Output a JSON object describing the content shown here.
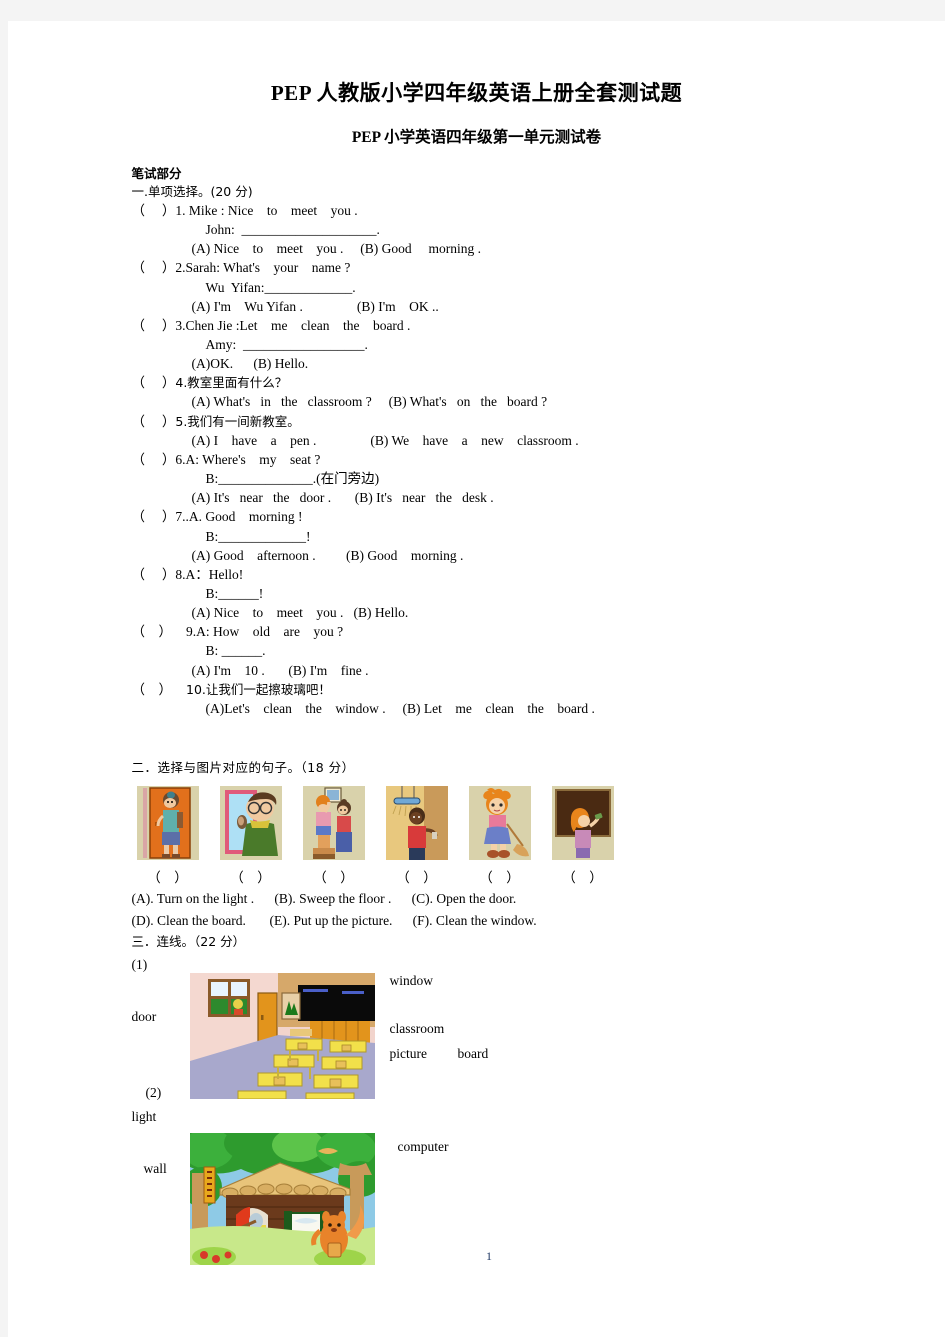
{
  "document": {
    "title": "PEP 人教版小学四年级英语上册全套测试题",
    "subtitle": "PEP 小学英语四年级第一单元测试卷",
    "page_number": "1"
  },
  "written_part": {
    "label": "笔试部分"
  },
  "section_one": {
    "heading": "一.单项选择。(20 分)",
    "questions": [
      {
        "bracket": "（     ）",
        "prompt": "1. Mike : Nice    to    meet    you .",
        "sub": "John:  ____________________.",
        "options": "(A) Nice    to    meet    you .     (B) Good     morning ."
      },
      {
        "bracket": "（     ）",
        "prompt": "2.Sarah: What's    your    name ?",
        "sub": "Wu  Yifan:_____________.",
        "options": "(A) I'm    Wu Yifan .                (B) I'm    OK .."
      },
      {
        "bracket": "（     ）",
        "prompt": "3.Chen Jie :Let    me    clean    the    board .",
        "sub": "Amy:  __________________.",
        "options": "(A)OK.      (B) Hello."
      },
      {
        "bracket": "（     ）",
        "prompt": "4.教室里面有什么？",
        "sub": "",
        "options": "(A) What's   in   the   classroom ?     (B) What's   on   the   board ?"
      },
      {
        "bracket": "（     ）",
        "prompt": "5.我们有一间新教室。",
        "sub": "",
        "options": "(A) I    have    a    pen .                (B) We    have    a    new    classroom ."
      },
      {
        "bracket": "（     ）",
        "prompt": "6.A: Where's    my    seat ?",
        "sub": "B:______________.(在门旁边)",
        "options": "(A) It's   near   the   door .       (B) It's   near   the   desk ."
      },
      {
        "bracket": "（     ）",
        "prompt": "7..A. Good    morning !",
        "sub": "B:_____________!",
        "options": "(A) Good    afternoon .         (B) Good    morning ."
      },
      {
        "bracket": "（     ）",
        "prompt": "8.A：Hello!",
        "sub": "B:______!",
        "options": "(A) Nice    to    meet    you .   (B) Hello."
      },
      {
        "bracket": "（    ）",
        "prompt": "9.A: How    old    are    you ?",
        "sub": "B: ______.",
        "options": "(A) I'm    10 .       (B) I'm    fine ."
      },
      {
        "bracket": "（    ）",
        "prompt": "10.让我们一起擦玻璃吧！",
        "sub": "",
        "options": "(A)Let's    clean    the    window .     (B) Let    me    clean    the    board ."
      }
    ]
  },
  "section_two": {
    "heading": "二．选择与图片对应的句子。（18 分）",
    "pictures": [
      {
        "name": "girl-opening-door",
        "bracket": "（    ）"
      },
      {
        "name": "boy-cleaning-window",
        "bracket": "（    ）"
      },
      {
        "name": "children-putting-up-picture",
        "bracket": "（    ）"
      },
      {
        "name": "boy-turning-on-light",
        "bracket": "（    ）"
      },
      {
        "name": "girl-sweeping-floor",
        "bracket": "（    ）"
      },
      {
        "name": "girl-cleaning-board",
        "bracket": "（    ）"
      }
    ],
    "options_row1": "(A). Turn on the light .      (B). Sweep the floor .      (C). Open the door.",
    "options_row2": "(D). Clean the board.       (E). Put up the picture.      (F). Clean the window."
  },
  "section_three": {
    "heading": "三．连线。（22 分）",
    "group_one": {
      "number": "(1)",
      "left_labels": [
        "door"
      ],
      "right_labels": [
        "window",
        "classroom",
        "picture",
        "board"
      ],
      "image_name": "classroom-illustration"
    },
    "group_two": {
      "number": "(2)",
      "left_labels": [
        "light",
        "wall"
      ],
      "right_labels": [
        "computer"
      ],
      "image_name": "log-cabin-illustration"
    }
  },
  "colors": {
    "page_background": "#ffffff",
    "outer_background": "#f4f4f4",
    "text": "#000000",
    "page_number": "#1f3864"
  }
}
